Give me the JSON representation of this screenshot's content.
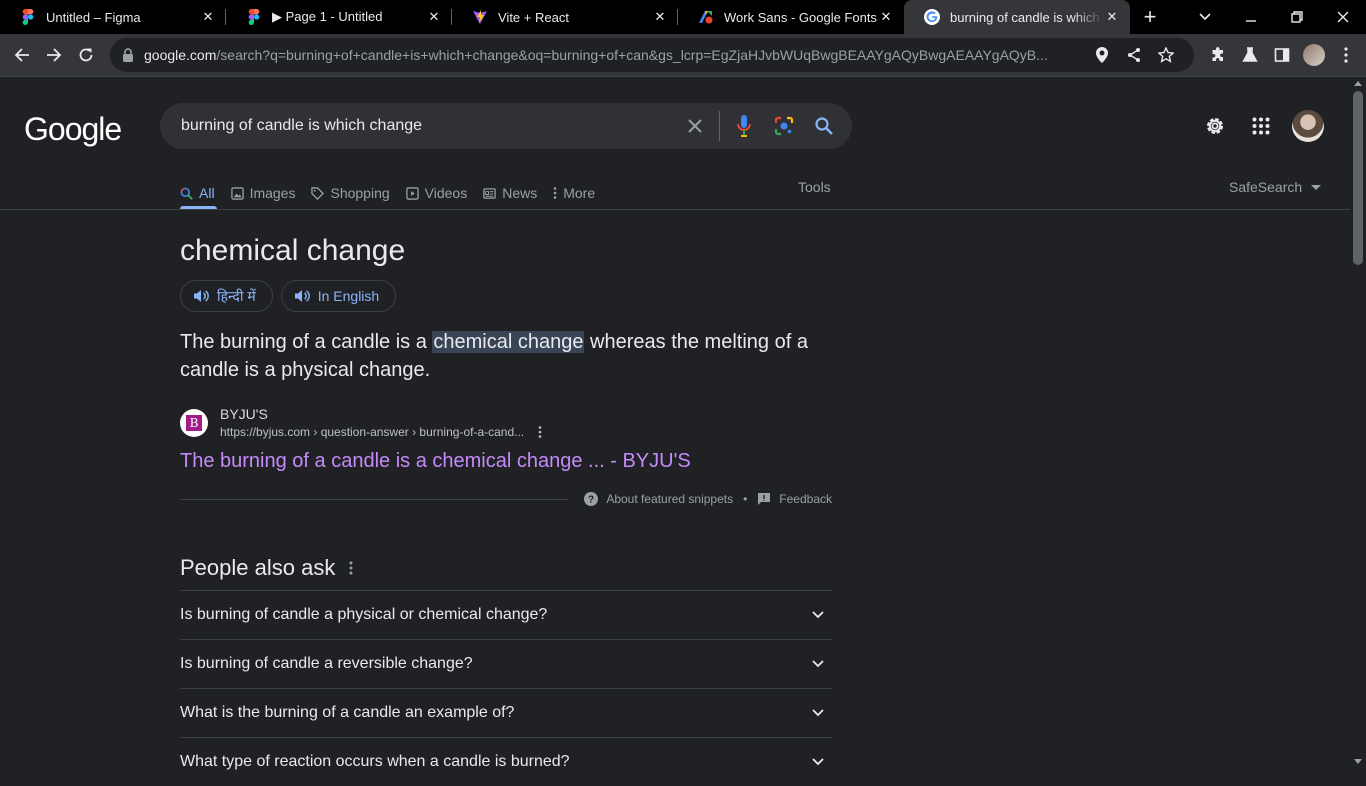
{
  "browser": {
    "tabs": [
      {
        "title": "Untitled – Figma",
        "icon": "figma-icon"
      },
      {
        "title": "▶ Page 1 - Untitled",
        "icon": "figma-icon"
      },
      {
        "title": "Vite + React",
        "icon": "vite-icon"
      },
      {
        "title": "Work Sans - Google Fonts",
        "icon": "google-fonts-icon"
      },
      {
        "title": "burning of candle is which change",
        "icon": "google-icon",
        "active": true
      }
    ],
    "url_host": "google.com",
    "url_rest": "/search?q=burning+of+candle+is+which+change&oq=burning+of+can&gs_lcrp=EgZjaHJvbWUqBwgBEAAYgAQyBwgAEAAYgAQyB..."
  },
  "google": {
    "logo": "Google",
    "query": "burning of candle is which change",
    "nav": [
      {
        "label": "All",
        "icon": "search-icon",
        "active": true
      },
      {
        "label": "Images",
        "icon": "image-icon"
      },
      {
        "label": "Shopping",
        "icon": "tag-icon"
      },
      {
        "label": "Videos",
        "icon": "video-icon"
      },
      {
        "label": "News",
        "icon": "news-icon"
      },
      {
        "label": "More",
        "icon": "more-vert-icon"
      }
    ],
    "tools": "Tools",
    "safesearch": "SafeSearch"
  },
  "answer": {
    "title": "chemical change",
    "lang_hindi": "हिन्दी में",
    "lang_english": "In English",
    "snippet_before": "The burning of a candle is a ",
    "snippet_highlight": "chemical change",
    "snippet_after": " whereas the melting of a candle is a physical change.",
    "source_name": "BYJU'S",
    "source_url": "https://byjus.com › question-answer › burning-of-a-cand...",
    "source_favicon_letter": "B",
    "result_title": "The burning of a candle is a chemical change ... - BYJU'S",
    "about_snippets": "About featured snippets",
    "bullet": "•",
    "feedback": "Feedback"
  },
  "paa": {
    "title": "People also ask",
    "questions": [
      "Is burning of candle a physical or chemical change?",
      "Is burning of candle a reversible change?",
      "What is the burning of a candle an example of?",
      "What type of reaction occurs when a candle is burned?"
    ]
  },
  "colors": {
    "accent": "#8ab4f8",
    "visited_link": "#c58af9",
    "background": "#202124"
  }
}
